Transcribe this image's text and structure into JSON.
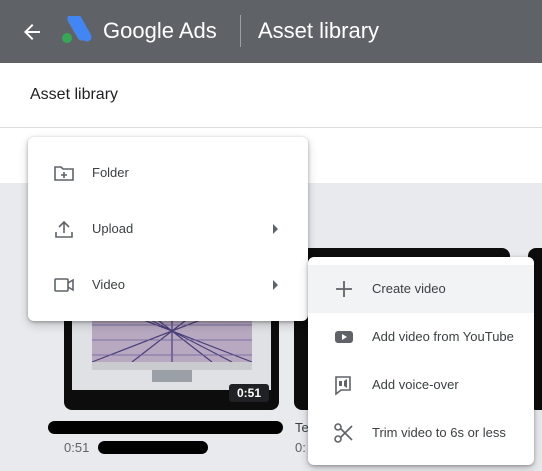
{
  "header": {
    "brand": "Google Ads",
    "title": "Asset library",
    "icons": [
      "back-arrow-icon",
      "google-ads-logo"
    ]
  },
  "subheader": {
    "title": "Asset library"
  },
  "new_menu": {
    "items": [
      {
        "label": "Folder",
        "icon": "folder-add-icon"
      },
      {
        "label": "Upload",
        "icon": "upload-icon",
        "submenu": true
      },
      {
        "label": "Video",
        "icon": "video-camera-icon",
        "submenu": true
      }
    ]
  },
  "video_submenu": {
    "items": [
      {
        "label": "Create video",
        "icon": "plus-icon"
      },
      {
        "label": "Add video from YouTube",
        "icon": "youtube-icon"
      },
      {
        "label": "Add voice-over",
        "icon": "voice-over-icon"
      },
      {
        "label": "Trim video to 6s or less",
        "icon": "scissors-icon"
      }
    ]
  },
  "assets": [
    {
      "duration_badge": "0:51",
      "title": "",
      "duration": "0:51"
    },
    {
      "duration_badge": "",
      "title": "Te",
      "duration": "0:"
    }
  ],
  "colors": {
    "topbar": "#5f6368",
    "logo_blue": "#4285f4",
    "logo_yellow": "#fbbc04",
    "logo_green": "#34a853"
  }
}
